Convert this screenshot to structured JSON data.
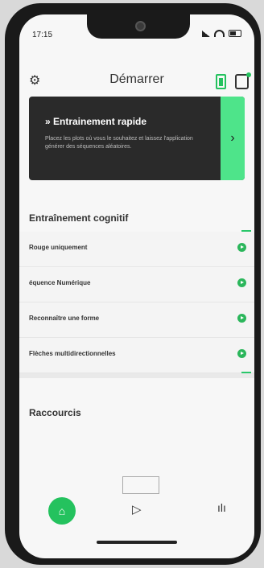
{
  "status": {
    "time": "17:15"
  },
  "header": {
    "title": "Démarrer"
  },
  "quick": {
    "title": "» Entrainement rapide",
    "description": "Placez les plots où vous le souhaitez et laissez l'application générer des séquences aléatoires.",
    "arrow": "›"
  },
  "cognitive": {
    "title": "Entraînement cognitif",
    "items": [
      {
        "label": "Rouge uniquement"
      },
      {
        "label": "équence Numérique"
      },
      {
        "label": "Reconnaître une forme"
      },
      {
        "label": "Flèches multidirectionnelles"
      }
    ]
  },
  "shortcuts": {
    "title": "Raccourcis"
  },
  "nav": {
    "home": "⌂",
    "play": "▷",
    "stats": "ılı"
  },
  "colors": {
    "accent": "#24c25e",
    "card": "#2a2a2a"
  }
}
